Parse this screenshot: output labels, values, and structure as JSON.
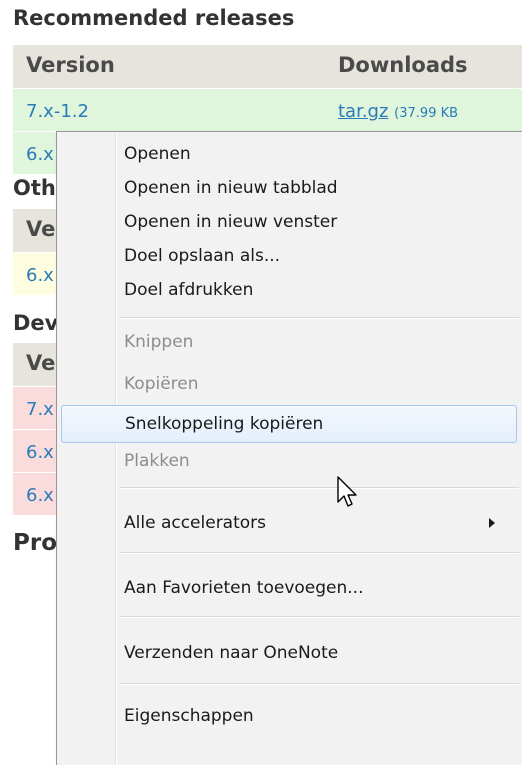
{
  "page": {
    "recommended": {
      "heading": "Recommended releases",
      "col_version": "Version",
      "col_downloads": "Downloads",
      "rows": [
        {
          "version": "7.x-1.2",
          "download": "tar.gz",
          "size": "(37.99 KB"
        },
        {
          "version": "6.x"
        }
      ]
    },
    "other": {
      "heading": "Oth",
      "col_version": "Ve",
      "rows": [
        {
          "version": "6.x"
        }
      ]
    },
    "development": {
      "heading": "Dev",
      "col_version": "Ve",
      "rows": [
        {
          "version": "7.x"
        },
        {
          "version": "6.x"
        },
        {
          "version": "6.x"
        }
      ]
    },
    "project": {
      "heading": "Pro"
    }
  },
  "context_menu": {
    "items": [
      {
        "label": "Openen",
        "disabled": false
      },
      {
        "label": "Openen in nieuw tabblad",
        "disabled": false
      },
      {
        "label": "Openen in nieuw venster",
        "disabled": false
      },
      {
        "label": "Doel opslaan als...",
        "disabled": false
      },
      {
        "label": "Doel afdrukken",
        "disabled": false
      },
      {
        "label": "Knippen",
        "disabled": true
      },
      {
        "label": "Kopiëren",
        "disabled": true
      },
      {
        "label": "Snelkoppeling kopiëren",
        "disabled": false,
        "highlighted": true
      },
      {
        "label": "Plakken",
        "disabled": true
      },
      {
        "label": "Alle accelerators",
        "disabled": false,
        "submenu": true
      },
      {
        "label": "Aan Favorieten toevoegen...",
        "disabled": false
      },
      {
        "label": "Verzenden naar OneNote",
        "disabled": false
      },
      {
        "label": "Eigenschappen",
        "disabled": false
      }
    ]
  },
  "colors": {
    "link": "#2b7bb9",
    "row_recommended": "#dff5dc",
    "row_other": "#fefde0",
    "row_development": "#fbdcdc",
    "menu_highlight_border": "#a9c6ec"
  },
  "icons": {
    "cursor": "arrow-pointer-icon",
    "submenu": "chevron-right-icon"
  }
}
